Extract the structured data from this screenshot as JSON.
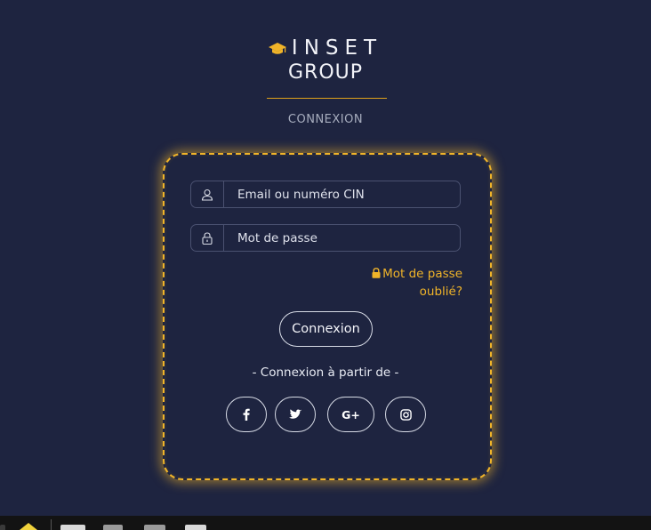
{
  "brand": {
    "name": "INSET",
    "group": "GROUP",
    "icon": "graduation-cap-icon"
  },
  "page": {
    "subtitle": "CONNEXION"
  },
  "login": {
    "email_placeholder": "Email ou numéro CIN",
    "password_placeholder": "Mot de passe",
    "forgot_line1": "Mot de passe",
    "forgot_line2": "oublié?",
    "submit_label": "Connexion",
    "social_caption": "- Connexion à partir de -",
    "social": {
      "facebook": "facebook-icon",
      "twitter": "twitter-icon",
      "google_plus": "G+",
      "instagram": "instagram-icon"
    }
  },
  "colors": {
    "background": "#1e2440",
    "accent": "#f0b429",
    "border": "#4a5170",
    "text": "#e9ecf4"
  }
}
